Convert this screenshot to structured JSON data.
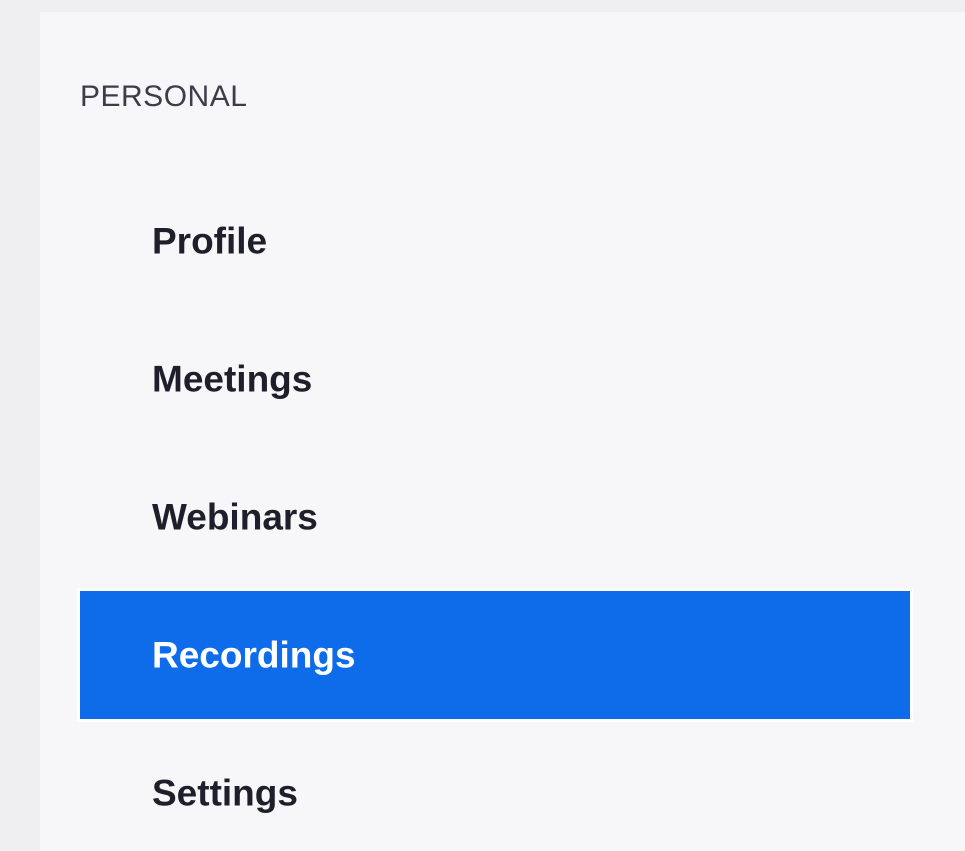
{
  "sidebar": {
    "section_header": "PERSONAL",
    "items": [
      {
        "label": "Profile",
        "active": false
      },
      {
        "label": "Meetings",
        "active": false
      },
      {
        "label": "Webinars",
        "active": false
      },
      {
        "label": "Recordings",
        "active": true
      },
      {
        "label": "Settings",
        "active": false
      }
    ]
  },
  "colors": {
    "page_background": "#efeff1",
    "sidebar_background": "#f7f7f9",
    "active_item_background": "#0e6ceb",
    "active_item_text": "#ffffff",
    "item_text": "#1f1f2b",
    "section_header_text": "#3d3d4a"
  }
}
